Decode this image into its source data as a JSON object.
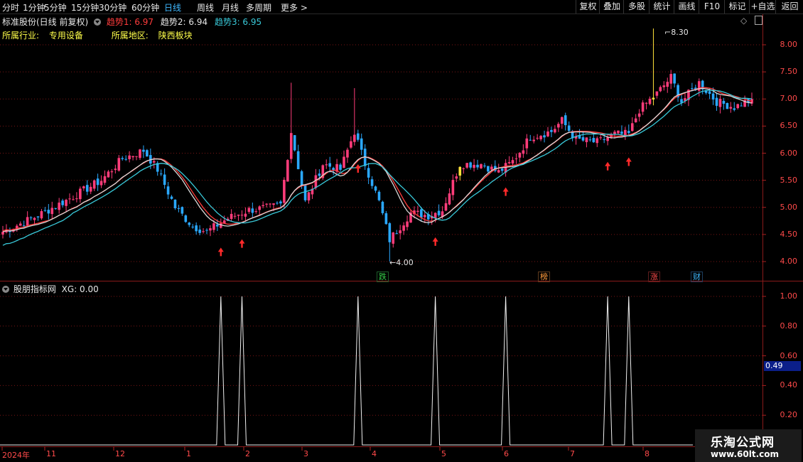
{
  "toolbar": {
    "tabs": [
      "分时",
      "1分钟",
      "5分钟",
      "15分钟",
      "30分钟",
      "60分钟",
      "日线",
      "周线",
      "月线",
      "多周期",
      "更多 >"
    ],
    "active_tab": "日线",
    "right_buttons": [
      "复权",
      "叠加",
      "多股",
      "统计",
      "画线",
      "F10",
      "标记",
      "+自选",
      "返回"
    ]
  },
  "main_chart": {
    "title": "标准股份(日线 前复权)",
    "trend1_label": "趋势1: 6.97",
    "trend2_label": "趋势2: 6.94",
    "trend3_label": "趋势3: 6.95",
    "industry_label": "所属行业:",
    "industry_value": "专用设备",
    "region_label": "所属地区:",
    "region_value": "陕西板块",
    "high_marker": "8.30",
    "low_marker": "4.00",
    "events": [
      "跌",
      "榜",
      "涨",
      "财"
    ]
  },
  "indicator": {
    "title": "股朋指标网",
    "xg_label": "XG: 0.00",
    "current_value": "0.49"
  },
  "date_axis": [
    "2024年",
    "11",
    "12",
    "1",
    "2",
    "3",
    "4",
    "5",
    "6",
    "7",
    "8"
  ],
  "watermark": {
    "line1": "乐淘公式网",
    "line2": "www.60lt.com"
  },
  "colors": {
    "up": "#ff3c7a",
    "down": "#2aa8ff",
    "trend1": "#ff3c3c",
    "trend2": "#d8d8d8",
    "trend3": "#39c9d9"
  },
  "chart_data": [
    {
      "type": "candlestick",
      "title": "标准股份(日线 前复权)",
      "y_ticks": [
        8.0,
        7.5,
        7.0,
        6.5,
        6.0,
        5.5,
        5.0,
        4.5,
        4.0
      ],
      "ylim": [
        3.85,
        8.4
      ],
      "x_ticks": [
        "2024年",
        "11",
        "12",
        "1",
        "2",
        "3",
        "4",
        "5",
        "6",
        "7",
        "8"
      ],
      "anchors": [
        {
          "i": 0,
          "c": 4.55
        },
        {
          "i": 10,
          "c": 4.85
        },
        {
          "i": 20,
          "c": 5.2
        },
        {
          "i": 28,
          "c": 5.5
        },
        {
          "i": 34,
          "c": 5.9
        },
        {
          "i": 40,
          "c": 6.05
        },
        {
          "i": 44,
          "c": 5.7
        },
        {
          "i": 49,
          "c": 5.0
        },
        {
          "i": 54,
          "c": 4.65
        },
        {
          "i": 58,
          "c": 4.55
        },
        {
          "i": 64,
          "c": 4.8
        },
        {
          "i": 70,
          "c": 4.95
        },
        {
          "i": 76,
          "c": 5.0
        },
        {
          "i": 79,
          "c": 5.05
        },
        {
          "i": 82,
          "c": 6.4
        },
        {
          "i": 86,
          "c": 5.1
        },
        {
          "i": 91,
          "c": 5.8
        },
        {
          "i": 96,
          "c": 5.7
        },
        {
          "i": 100,
          "c": 6.4
        },
        {
          "i": 103,
          "c": 5.8
        },
        {
          "i": 107,
          "c": 5.1
        },
        {
          "i": 110,
          "c": 4.4
        },
        {
          "i": 116,
          "c": 4.9
        },
        {
          "i": 121,
          "c": 4.85
        },
        {
          "i": 125,
          "c": 4.95
        },
        {
          "i": 130,
          "c": 5.8
        },
        {
          "i": 136,
          "c": 5.8
        },
        {
          "i": 141,
          "c": 5.65
        },
        {
          "i": 145,
          "c": 5.85
        },
        {
          "i": 150,
          "c": 6.3
        },
        {
          "i": 156,
          "c": 6.4
        },
        {
          "i": 159,
          "c": 6.6
        },
        {
          "i": 163,
          "c": 6.25
        },
        {
          "i": 169,
          "c": 6.2
        },
        {
          "i": 174,
          "c": 6.35
        },
        {
          "i": 178,
          "c": 6.35
        },
        {
          "i": 181,
          "c": 6.8
        },
        {
          "i": 186,
          "c": 7.1
        },
        {
          "i": 190,
          "c": 7.4
        },
        {
          "i": 193,
          "c": 6.95
        },
        {
          "i": 198,
          "c": 7.3
        },
        {
          "i": 203,
          "c": 6.95
        },
        {
          "i": 208,
          "c": 6.85
        },
        {
          "i": 213,
          "c": 7.0
        }
      ],
      "spikes": [
        {
          "i": 82,
          "h": 7.3
        },
        {
          "i": 100,
          "h": 7.2
        },
        {
          "i": 110,
          "l": 4.0
        },
        {
          "i": 185,
          "h": 8.3
        }
      ],
      "signals": [
        62,
        68,
        101,
        123,
        143,
        172,
        178
      ],
      "series": [
        {
          "name": "趋势1",
          "value": 6.97
        },
        {
          "name": "趋势2",
          "value": 6.94
        },
        {
          "name": "趋势3",
          "value": 6.95
        }
      ]
    },
    {
      "type": "line",
      "title": "股朋指标网",
      "y_ticks": [
        1.0,
        0.8,
        0.6,
        0.4,
        0.2
      ],
      "ylim": [
        0,
        1.05
      ],
      "signal_bars": [
        62,
        68,
        101,
        123,
        143,
        172,
        178
      ],
      "xg": 0.0,
      "cursor_value": 0.49
    }
  ]
}
